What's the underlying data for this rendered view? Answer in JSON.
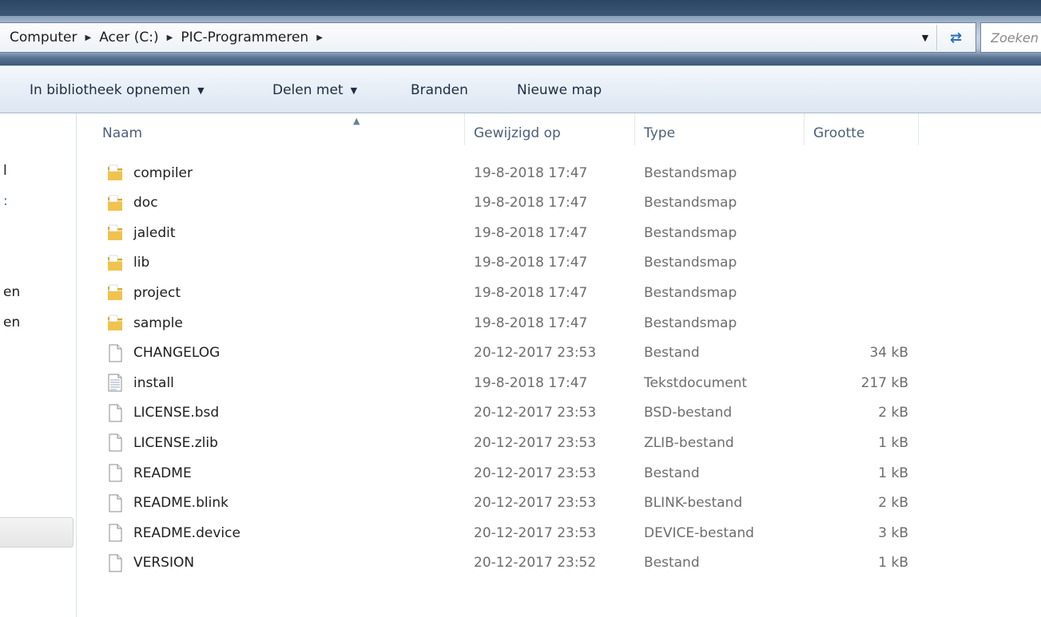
{
  "address": {
    "crumbs": [
      "Computer",
      "Acer (C:)",
      "PIC-Programmeren"
    ],
    "search_placeholder": "Zoeken"
  },
  "toolbar": {
    "include_library": "In bibliotheek opnemen",
    "share_with": "Delen met",
    "burn": "Branden",
    "new_folder": "Nieuwe map"
  },
  "nav_fragments": [
    "l",
    ":",
    "en",
    "en"
  ],
  "columns": {
    "name": "Naam",
    "modified": "Gewijzigd op",
    "type": "Type",
    "size": "Grootte"
  },
  "files": [
    {
      "name": "compiler",
      "modified": "19-8-2018 17:47",
      "type": "Bestandsmap",
      "size": "",
      "icon": "folder-icon"
    },
    {
      "name": "doc",
      "modified": "19-8-2018 17:47",
      "type": "Bestandsmap",
      "size": "",
      "icon": "folder-icon"
    },
    {
      "name": "jaledit",
      "modified": "19-8-2018 17:47",
      "type": "Bestandsmap",
      "size": "",
      "icon": "folder-icon"
    },
    {
      "name": "lib",
      "modified": "19-8-2018 17:47",
      "type": "Bestandsmap",
      "size": "",
      "icon": "folder-icon"
    },
    {
      "name": "project",
      "modified": "19-8-2018 17:47",
      "type": "Bestandsmap",
      "size": "",
      "icon": "folder-icon"
    },
    {
      "name": "sample",
      "modified": "19-8-2018 17:47",
      "type": "Bestandsmap",
      "size": "",
      "icon": "folder-icon"
    },
    {
      "name": "CHANGELOG",
      "modified": "20-12-2017 23:53",
      "type": "Bestand",
      "size": "34 kB",
      "icon": "file-icon"
    },
    {
      "name": "install",
      "modified": "19-8-2018 17:47",
      "type": "Tekstdocument",
      "size": "217 kB",
      "icon": "text-file-icon"
    },
    {
      "name": "LICENSE.bsd",
      "modified": "20-12-2017 23:53",
      "type": "BSD-bestand",
      "size": "2 kB",
      "icon": "file-icon"
    },
    {
      "name": "LICENSE.zlib",
      "modified": "20-12-2017 23:53",
      "type": "ZLIB-bestand",
      "size": "1 kB",
      "icon": "file-icon"
    },
    {
      "name": "README",
      "modified": "20-12-2017 23:53",
      "type": "Bestand",
      "size": "1 kB",
      "icon": "file-icon"
    },
    {
      "name": "README.blink",
      "modified": "20-12-2017 23:53",
      "type": "BLINK-bestand",
      "size": "2 kB",
      "icon": "file-icon"
    },
    {
      "name": "README.device",
      "modified": "20-12-2017 23:53",
      "type": "DEVICE-bestand",
      "size": "3 kB",
      "icon": "file-icon"
    },
    {
      "name": "VERSION",
      "modified": "20-12-2017 23:52",
      "type": "Bestand",
      "size": "1 kB",
      "icon": "file-icon"
    }
  ]
}
